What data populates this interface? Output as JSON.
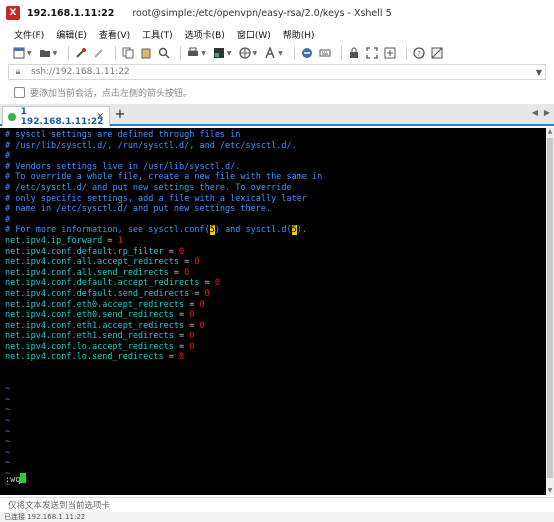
{
  "window": {
    "title_host": "192.168.1.11:22",
    "title_path": "root@simple:/etc/openvpn/easy-rsa/2.0/keys - Xshell 5"
  },
  "menu": [
    "文件(F)",
    "编辑(E)",
    "查看(V)",
    "工具(T)",
    "选项卡(B)",
    "窗口(W)",
    "帮助(H)"
  ],
  "address": {
    "text": "ssh://192.168.1.11:22"
  },
  "info": {
    "text": "要添加当前会话，点击左侧的箭头按钮。"
  },
  "tabs": {
    "active_label": "1 192.168.1.11:22",
    "add_label": "+"
  },
  "terminal": {
    "comments": [
      "# sysctl settings are defined through files in",
      "# /usr/lib/sysctl.d/, /run/sysctl.d/, and /etc/sysctl.d/.",
      "#",
      "# Vendors settings live in /usr/lib/sysctl.d/.",
      "# To override a whole file, create a new file with the same in",
      "# /etc/sysctl.d/ and put new settings there. To override",
      "# only specific settings, add a file with a lexically later",
      "# name in /etc/sysctl.d/ and put new settings there.",
      "#"
    ],
    "info_line": {
      "prefix": "# For more information, see sysctl.conf(",
      "hl1": "5",
      "middle": ") and sysctl.d(",
      "hl2": "5",
      "suffix": ")."
    },
    "settings": [
      {
        "key": "net.ipv4.ip_forward",
        "value": "1"
      },
      {
        "key": "net.ipv4.conf.default.rp_filter",
        "value": "0"
      },
      {
        "key": "net.ipv4.conf.all.accept_redirects",
        "value": "0"
      },
      {
        "key": "net.ipv4.conf.all.send_redirects",
        "value": "0"
      },
      {
        "key": "net.ipv4.conf.default.accept_redirects",
        "value": "0"
      },
      {
        "key": "net.ipv4.conf.default.send_redirects",
        "value": "0"
      },
      {
        "key": "net.ipv4.conf.eth0.accept_redirects",
        "value": "0"
      },
      {
        "key": "net.ipv4.conf.eth0.send_redirects",
        "value": "0"
      },
      {
        "key": "net.ipv4.conf.eth1.accept_redirects",
        "value": "0"
      },
      {
        "key": "net.ipv4.conf.eth1.send_redirects",
        "value": "0"
      },
      {
        "key": "net.ipv4.conf.lo.accept_redirects",
        "value": "0"
      },
      {
        "key": "net.ipv4.conf.lo.send_redirects",
        "value": "0"
      }
    ],
    "tilde_lines": [
      "~",
      "~",
      "~",
      "~",
      "~",
      "~",
      "~",
      "~",
      "~",
      "~"
    ],
    "command": ":wq"
  },
  "compose": {
    "placeholder": "仅将文本发送到当前选项卡"
  },
  "status": {
    "text": "已连接 192.168.1.11:22"
  },
  "colors": {
    "comment": "#3f8fff",
    "key": "#20c8c8",
    "value": "#e02020",
    "highlight": "#e8d000",
    "cursor": "#28d128",
    "tab_accent": "#2d7fd6"
  },
  "icons": {
    "toolbar": [
      "new-session-icon",
      "open-folder-icon",
      "reconnect-icon",
      "disconnect-icon",
      "copy-icon",
      "paste-icon",
      "find-icon",
      "print-icon",
      "color-scheme-icon",
      "globe-icon",
      "font-icon",
      "xftp-icon",
      "keyboard-icon",
      "lock-icon",
      "fullscreen-icon",
      "send-icon",
      "help-icon",
      "transparency-icon"
    ]
  }
}
